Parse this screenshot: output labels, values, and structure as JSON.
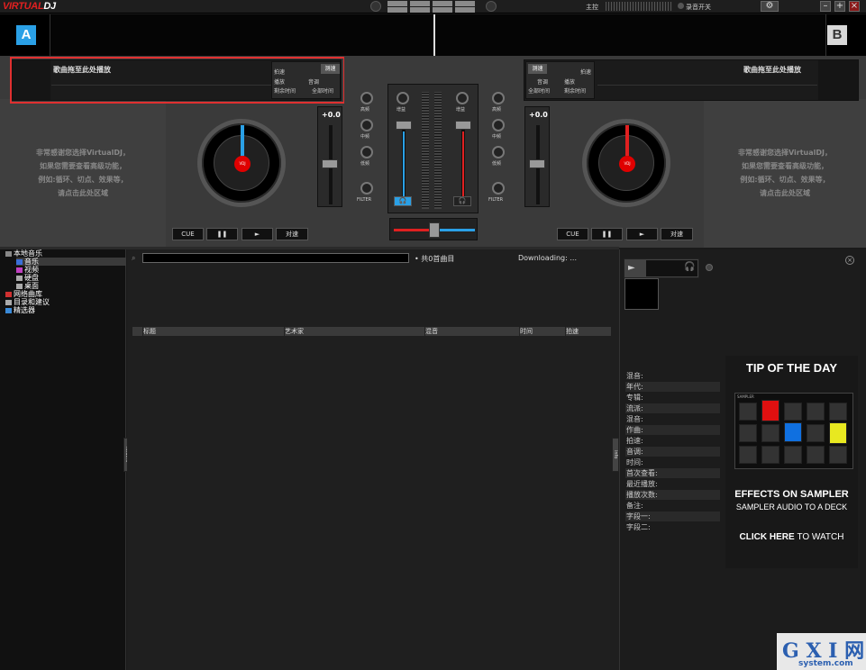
{
  "app": {
    "logo_left": "VIRTUAL",
    "logo_right": "DJ",
    "top_label_master": "主控",
    "top_label_record": "录音开关"
  },
  "window_controls": {
    "minimize": "–",
    "maximize": "+",
    "close": "×",
    "settings": "⚙"
  },
  "deck_a": {
    "badge": "A",
    "title": "歌曲拖至此处播放",
    "bpm_label": "拍速",
    "bpm_value": "测速",
    "play_label": "播放",
    "key_label": "音调",
    "remain_label": "剩余时间",
    "total_label": "全部时间",
    "pitch": "+0.0",
    "hint": [
      "非常感谢您选择VirtualDJ，",
      "如果您需要查看高级功能，",
      "例如:循环、切点、效果等，",
      "请点击此处区域"
    ],
    "buttons": {
      "cue": "CUE",
      "pause": "❚❚",
      "play": "►",
      "sync": "对速"
    }
  },
  "deck_b": {
    "badge": "B",
    "title": "歌曲拖至此处播放",
    "bpm_label": "拍速",
    "bpm_value": "测速",
    "play_label": "播放",
    "key_label": "音调",
    "remain_label": "剩余时间",
    "total_label": "全部时间",
    "pitch": "+0.0",
    "hint": [
      "非常感谢您选择VirtualDJ，",
      "如果您需要查看高级功能，",
      "例如:循环、切点、效果等，",
      "请点击此处区域"
    ],
    "buttons": {
      "cue": "CUE",
      "pause": "❚❚",
      "play": "►",
      "sync": "对速"
    }
  },
  "mixer": {
    "gain": "增益",
    "high": "高频",
    "mid": "中频",
    "low": "低频",
    "filter": "FILTER",
    "headphone": "🎧"
  },
  "tree": {
    "items": [
      {
        "label": "本地音乐",
        "color": "#888"
      },
      {
        "label": "音乐",
        "color": "#3a6fd8"
      },
      {
        "label": "视频",
        "color": "#c040c0"
      },
      {
        "label": "硬盘",
        "color": "#aaa"
      },
      {
        "label": "桌面",
        "color": "#aaa"
      },
      {
        "label": "网络曲库",
        "color": "#d03030"
      },
      {
        "label": "目录和建议",
        "color": "#aaa"
      },
      {
        "label": "精选器",
        "color": "#3a8ad8"
      }
    ]
  },
  "browser": {
    "count": "共0首曲目",
    "downloading": "Downloading: ...",
    "columns": [
      "标题",
      "艺术家",
      "混音",
      "时间",
      "拍速"
    ],
    "folders_tab": "folders",
    "info_tab": "info"
  },
  "info": {
    "fields": [
      "混音:",
      "年代:",
      "专辑:",
      "流派:",
      "混音:",
      "作曲:",
      "拍速:",
      "音调:",
      "时间:",
      "首次查看:",
      "最近播放:",
      "播放次数:",
      "备注:",
      "字段一:",
      "字段二:"
    ]
  },
  "tip": {
    "heading": "TIP OF THE DAY",
    "title1": "EFFECTS ON SAMPLER",
    "title2": "SAMPLER AUDIO TO A DECK",
    "cta_strong": "CLICK HERE",
    "cta_rest": "TO WATCH",
    "grid_label": "SAMPLER"
  },
  "watermark": {
    "brand": "G X I 网",
    "site": "system.com"
  },
  "colors": {
    "accent_blue": "#2aa0e6",
    "accent_red": "#e02020",
    "highlight_red": "#e03030"
  }
}
